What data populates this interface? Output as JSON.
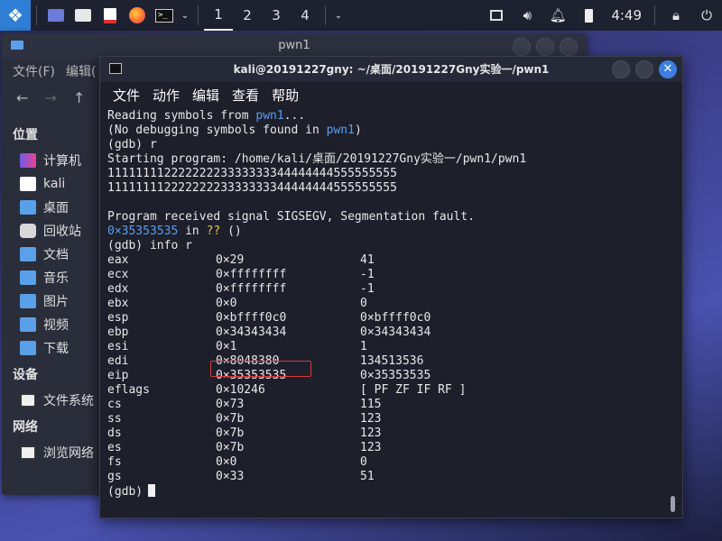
{
  "panel": {
    "workspaces": [
      "1",
      "2",
      "3",
      "4"
    ],
    "active_workspace": "1",
    "clock": "4:49",
    "icons": [
      "kali-menu-icon",
      "desktop-icon",
      "files-icon",
      "text-editor-icon",
      "firefox-icon",
      "terminal-icon",
      "network-icon",
      "volume-icon",
      "notification-icon",
      "battery-icon",
      "lock-icon",
      "power-icon"
    ]
  },
  "file_manager": {
    "title": "pwn1",
    "menu": [
      "文件(F)",
      "编辑("
    ],
    "sidebar": {
      "sections": [
        {
          "title": "位置",
          "items": [
            "计算机",
            "kali",
            "桌面",
            "回收站",
            "文档",
            "音乐",
            "图片",
            "视频",
            "下载"
          ]
        },
        {
          "title": "设备",
          "items": [
            "文件系统"
          ]
        },
        {
          "title": "网络",
          "items": [
            "浏览网络"
          ]
        }
      ]
    }
  },
  "terminal": {
    "title": "kali@20191227gny: ~/桌面/20191227Gny实验一/pwn1",
    "menu": [
      "文件",
      "动作",
      "编辑",
      "查看",
      "帮助"
    ],
    "lines": {
      "l1_a": "Reading symbols from ",
      "l1_b": "pwn1",
      "l1_c": "...",
      "l2_a": "(No debugging symbols found in ",
      "l2_b": "pwn1",
      "l2_c": ")",
      "l3": "(gdb) r",
      "l4": "Starting program: /home/kali/桌面/20191227Gny实验一/pwn1/pwn1",
      "l5": "11111111222222223333333344444444555555555",
      "l6": "11111111222222223333333344444444555555555",
      "l7": "",
      "l8": "Program received signal SIGSEGV, Segmentation fault.",
      "l9_a": "0×35353535",
      "l9_b": " in ",
      "l9_c": "??",
      "l9_d": " ()",
      "l10": "(gdb) info r",
      "prompt": "(gdb)"
    },
    "registers": [
      {
        "name": "eax",
        "hex": "0×29",
        "val": "41"
      },
      {
        "name": "ecx",
        "hex": "0×ffffffff",
        "val": "-1"
      },
      {
        "name": "edx",
        "hex": "0×ffffffff",
        "val": "-1"
      },
      {
        "name": "ebx",
        "hex": "0×0",
        "val": "0"
      },
      {
        "name": "esp",
        "hex": "0×bffff0c0",
        "val": "0×bffff0c0"
      },
      {
        "name": "ebp",
        "hex": "0×34343434",
        "val": "0×34343434"
      },
      {
        "name": "esi",
        "hex": "0×1",
        "val": "1"
      },
      {
        "name": "edi",
        "hex": "0×8048380",
        "val": "134513536"
      },
      {
        "name": "eip",
        "hex": "0×35353535",
        "val": "0×35353535"
      },
      {
        "name": "eflags",
        "hex": "0×10246",
        "val": "[ PF ZF IF RF ]"
      },
      {
        "name": "cs",
        "hex": "0×73",
        "val": "115"
      },
      {
        "name": "ss",
        "hex": "0×7b",
        "val": "123"
      },
      {
        "name": "ds",
        "hex": "0×7b",
        "val": "123"
      },
      {
        "name": "es",
        "hex": "0×7b",
        "val": "123"
      },
      {
        "name": "fs",
        "hex": "0×0",
        "val": "0"
      },
      {
        "name": "gs",
        "hex": "0×33",
        "val": "51"
      }
    ],
    "highlight_color": "#d83a3a"
  }
}
